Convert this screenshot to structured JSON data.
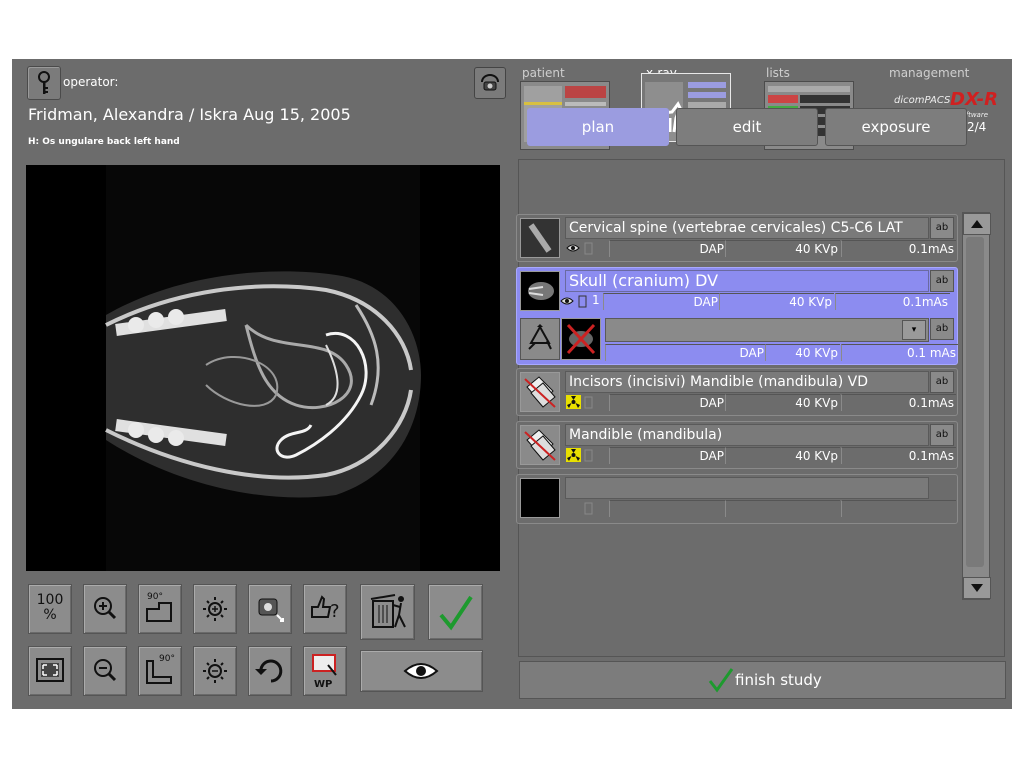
{
  "header": {
    "operator_label": "operator:",
    "patient_line": "Fridman, Alexandra / Iskra  Aug 15, 2005",
    "study_label": "H: Os ungulare back left hand"
  },
  "nav": {
    "patient": "patient",
    "xray": "x-ray",
    "lists": "lists",
    "management": "management"
  },
  "logo": {
    "brand": "dicomPACS",
    "product": "DX-R",
    "tagline": "X-ray Acquisition Software"
  },
  "toolbar": {
    "zoom_100_top": "100",
    "zoom_100_bottom": "%",
    "rotate_90": "90°",
    "rotate_neg90": "90°",
    "wp_label": "WP"
  },
  "tabs": {
    "plan": "plan",
    "edit": "edit",
    "exposure": "exposure",
    "page": "2/4"
  },
  "rows": [
    {
      "title": "Cervical spine (vertebrae cervicales) C5-C6 LAT",
      "count": "",
      "dap": "DAP",
      "kvp": "40 KVp",
      "mas": "0.1mAs"
    },
    {
      "title": "Skull (cranium) DV",
      "count": "1",
      "dap": "DAP",
      "kvp": "40 KVp",
      "mas": "0.1mAs"
    },
    {
      "title": "",
      "count": "",
      "dap": "DAP",
      "kvp": "40 KVp",
      "mas": "0.1 mAs"
    },
    {
      "title": "Incisors (incisivi) Mandible (mandibula) VD",
      "count": "",
      "dap": "DAP",
      "kvp": "40 KVp",
      "mas": "0.1mAs"
    },
    {
      "title": "Mandible (mandibula)",
      "count": "",
      "dap": "DAP",
      "kvp": "40 KVp",
      "mas": "0.1mAs"
    },
    {
      "title": "",
      "count": "",
      "dap": "",
      "kvp": "",
      "mas": ""
    }
  ],
  "edit_label": "ab",
  "finish_label": "finish study"
}
